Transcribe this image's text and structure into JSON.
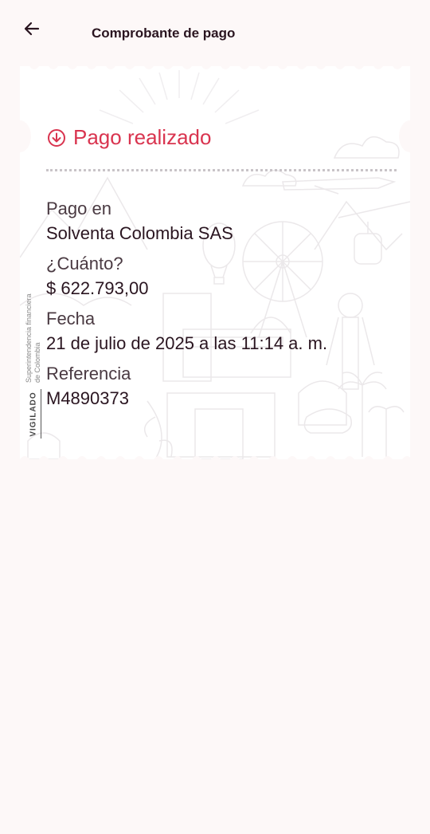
{
  "header": {
    "title": "Comprobante de pago",
    "back_icon": "arrow-left-icon"
  },
  "receipt": {
    "status": {
      "icon": "arrow-down-circle-icon",
      "label": "Pago realizado",
      "color": "#d9344f"
    },
    "fields": [
      {
        "label": "Pago en",
        "value": "Solventa Colombia SAS"
      },
      {
        "label": "¿Cuánto?",
        "value": "$ 622.793,00"
      },
      {
        "label": "Fecha",
        "value": "21 de julio de 2025 a las 11:14 a. m."
      },
      {
        "label": "Referencia",
        "value": "M4890373"
      }
    ]
  },
  "vigilado": {
    "word": "VIGILADO",
    "entity_line1": "Superintendencia financiera",
    "entity_line2": "de Colombia"
  },
  "colors": {
    "background": "#fdf8f8",
    "card": "#ffffff",
    "accent": "#d9344f",
    "text": "#2a1520"
  }
}
